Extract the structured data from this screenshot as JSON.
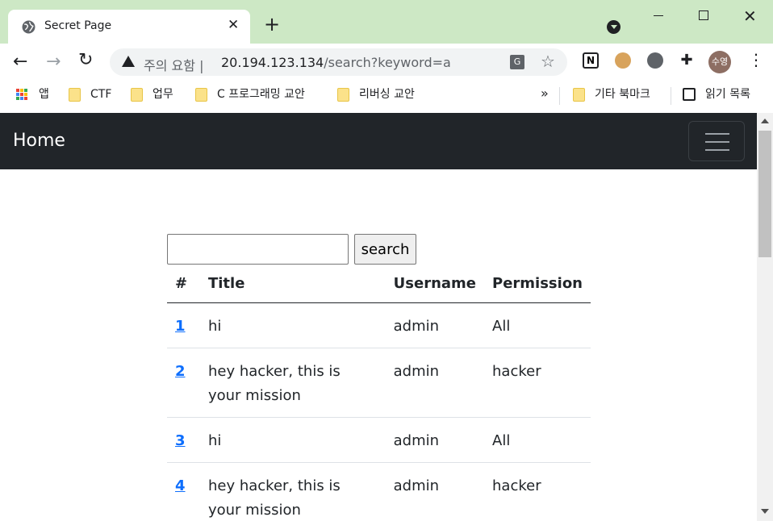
{
  "browser": {
    "tab": {
      "title": "Secret Page",
      "close": "✕"
    },
    "new_tab": "+",
    "window": {
      "close": "✕"
    },
    "nav": {
      "back": "←",
      "forward": "→",
      "reload": "↻"
    },
    "omnibox": {
      "warning": "주의 요함",
      "separator": "|",
      "host": "20.194.123.134",
      "path": "/search?keyword=a"
    },
    "translate_glyph": "G",
    "star": "☆",
    "extensions": {
      "notion": "N",
      "puzzle": "✚"
    },
    "profile": "수영",
    "menu": "⋮"
  },
  "bookmarks": {
    "items": [
      {
        "label": "앱",
        "icon": "apps-icon"
      },
      {
        "label": "CTF",
        "icon": "folder-icon"
      },
      {
        "label": "업무",
        "icon": "folder-icon"
      },
      {
        "label": "C 프로그래밍 교안",
        "icon": "folder-icon"
      },
      {
        "label": "리버싱 교안",
        "icon": "folder-icon"
      }
    ],
    "more": "»",
    "other": "기타 북마크",
    "reading_list": "읽기 목록"
  },
  "page": {
    "navbar": {
      "brand": "Home"
    },
    "search": {
      "value": "",
      "button": "search"
    },
    "table": {
      "headers": [
        "#",
        "Title",
        "Username",
        "Permission"
      ],
      "rows": [
        {
          "id": "1",
          "title": "hi",
          "username": "admin",
          "permission": "All"
        },
        {
          "id": "2",
          "title": "hey hacker, this is your mission",
          "username": "admin",
          "permission": "hacker"
        },
        {
          "id": "3",
          "title": "hi",
          "username": "admin",
          "permission": "All"
        },
        {
          "id": "4",
          "title": "hey hacker, this is your mission",
          "username": "admin",
          "permission": "hacker"
        }
      ]
    }
  },
  "colors": {
    "titlebar": "#cde8c5",
    "navbar": "#212529",
    "link": "#0d6efd"
  }
}
